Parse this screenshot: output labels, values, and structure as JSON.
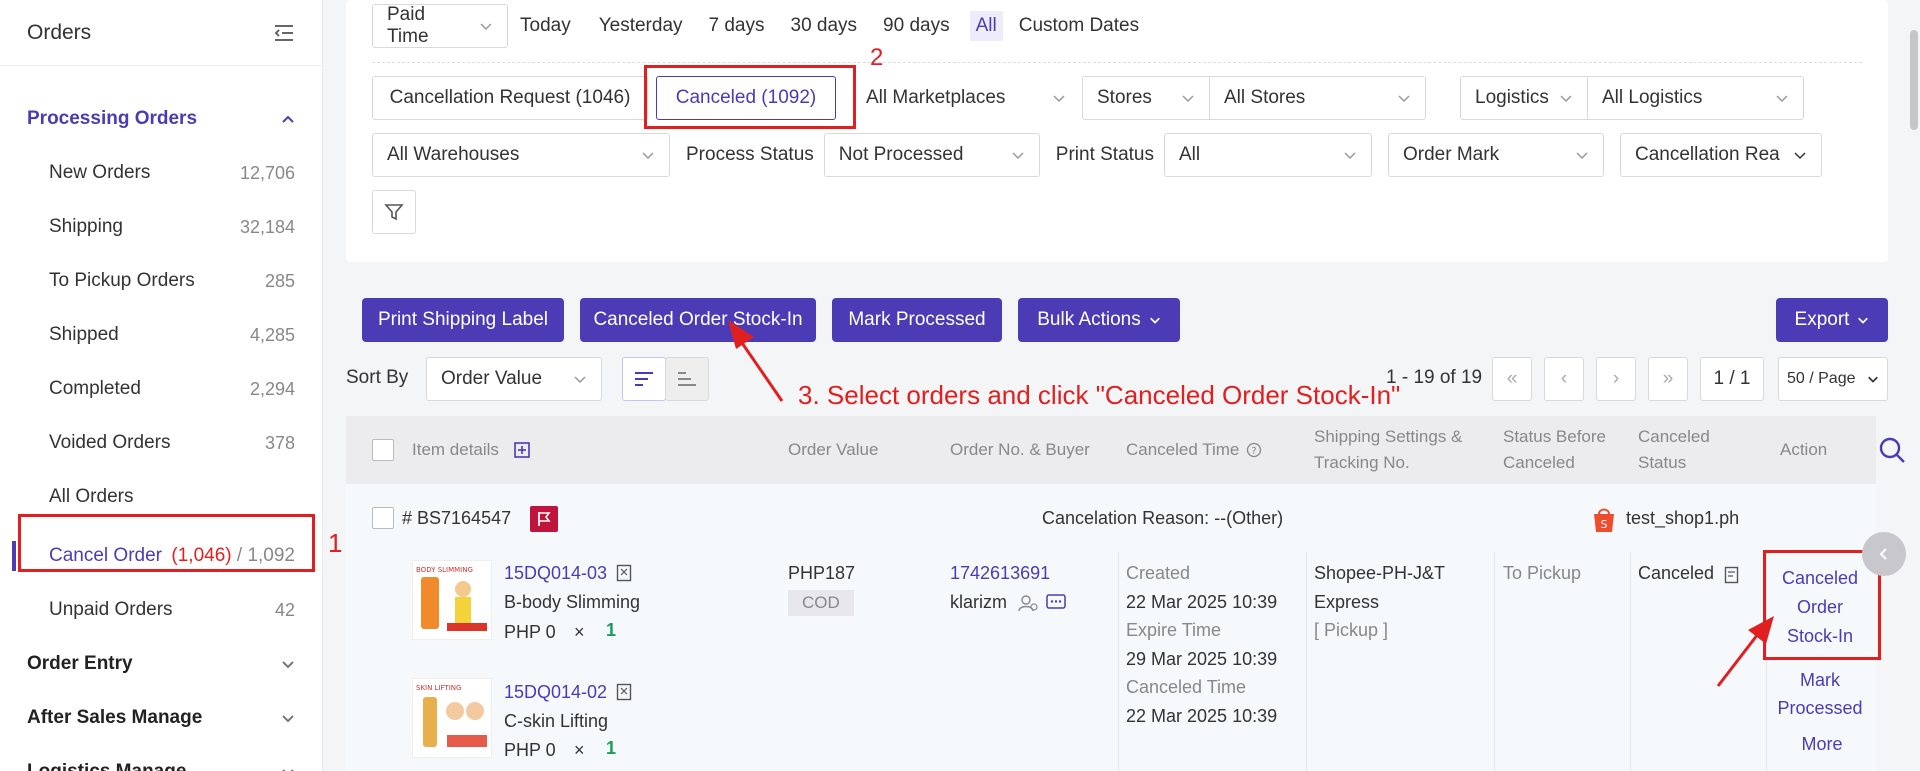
{
  "sidebar": {
    "title": "Orders",
    "processing_group": "Processing Orders",
    "items": [
      {
        "label": "New Orders",
        "count": "12,706"
      },
      {
        "label": "Shipping",
        "count": "32,184"
      },
      {
        "label": "To Pickup Orders",
        "count": "285"
      },
      {
        "label": "Shipped",
        "count": "4,285"
      },
      {
        "label": "Completed",
        "count": "2,294"
      },
      {
        "label": "Voided Orders",
        "count": "378"
      },
      {
        "label": "All Orders",
        "count": ""
      }
    ],
    "cancel_order": {
      "label": "Cancel Order",
      "count_red": "(1,046)",
      "sep": "/",
      "count_total": "1,092"
    },
    "unpaid": {
      "label": "Unpaid Orders",
      "count": "42"
    },
    "groups": [
      "Order Entry",
      "After Sales Manage",
      "Logistics Manage"
    ]
  },
  "filters": {
    "paid_time": "Paid Time",
    "dates": [
      "Today",
      "Yesterday",
      "7 days",
      "30 days",
      "90 days",
      "All",
      "Custom Dates"
    ],
    "cancel_request": "Cancellation Request (1046)",
    "canceled": "Canceled (1092)",
    "marketplaces": "All Marketplaces",
    "stores_label": "Stores",
    "stores_value": "All Stores",
    "logistics_label": "Logistics",
    "logistics_value": "All Logistics",
    "warehouses": "All Warehouses",
    "process_status_label": "Process Status",
    "process_status_value": "Not Processed",
    "print_status_label": "Print Status",
    "print_status_value": "All",
    "order_mark": "Order Mark",
    "cancellation_reason": "Cancellation Rea"
  },
  "toolbar": {
    "print_label": "Print Shipping Label",
    "stock_in": "Canceled Order Stock-In",
    "mark_processed": "Mark Processed",
    "bulk_actions": "Bulk Actions",
    "export": "Export",
    "sort_by": "Sort By",
    "sort_value": "Order Value",
    "range": "1 - 19 of 19",
    "page": "1 / 1",
    "per_page": "50 / Page"
  },
  "annotations": {
    "a1": "1",
    "a2": "2",
    "a3": "3. Select orders and click \"Canceled Order Stock-In\""
  },
  "table": {
    "headers": {
      "item": "Item details",
      "value": "Order Value",
      "order_no": "Order No. & Buyer",
      "canceled_time": "Canceled Time",
      "shipping_1": "Shipping Settings &",
      "shipping_2": "Tracking No.",
      "status_before_1": "Status Before",
      "status_before_2": "Canceled",
      "canceled_status_1": "Canceled",
      "canceled_status_2": "Status",
      "action": "Action"
    },
    "order": {
      "id": "# BS7164547",
      "reason": "Cancelation Reason: --(Other)",
      "shop": "test_shop1.ph",
      "items": [
        {
          "sku": "15DQ014-03",
          "name": "B-body Slimming",
          "price": "PHP 0",
          "times": "×",
          "qty": "1",
          "thumb_text": "BODY SLIMMING"
        },
        {
          "sku": "15DQ014-02",
          "name": "C-skin Lifting",
          "price": "PHP 0",
          "times": "×",
          "qty": "1",
          "thumb_text": "SKIN LIFTING"
        }
      ],
      "value": "PHP187",
      "payment": "COD",
      "order_no": "1742613691",
      "buyer": "klarizm",
      "created_label": "Created",
      "created": "22 Mar 2025 10:39",
      "expire_label": "Expire Time",
      "expire": "29 Mar 2025 10:39",
      "canceled_label": "Canceled Time",
      "canceled": "22 Mar 2025 10:39",
      "shipping_1": "Shopee-PH-J&T",
      "shipping_2": "Express",
      "shipping_3": "[ Pickup ]",
      "status_before": "To Pickup",
      "canceled_status": "Canceled",
      "actions": {
        "stock_in_1": "Canceled",
        "stock_in_2": "Order",
        "stock_in_3": "Stock-In",
        "mark_1": "Mark",
        "mark_2": "Processed",
        "more": "More"
      }
    }
  },
  "colors": {
    "accent": "#4b3bb5",
    "annotation": "#e02020",
    "shopee": "#ee4d2d"
  }
}
